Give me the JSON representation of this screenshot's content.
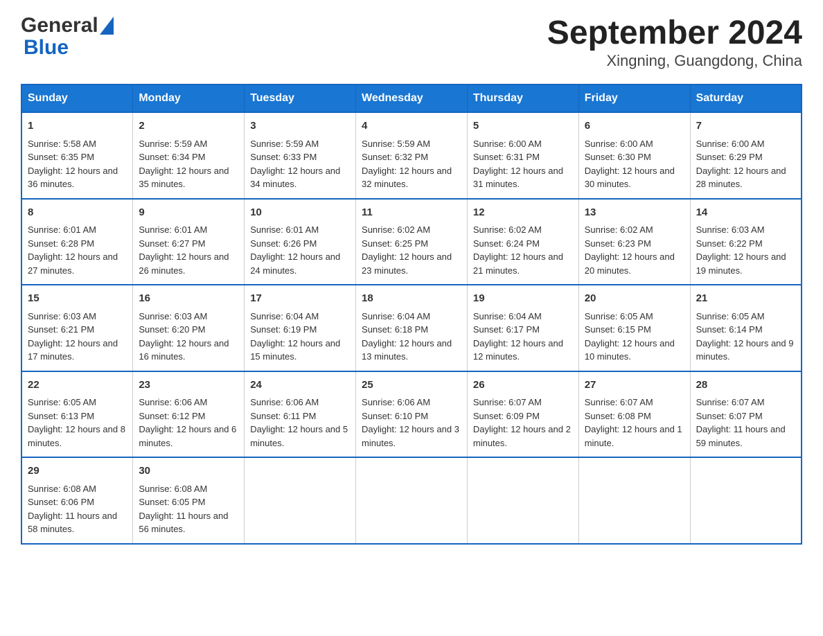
{
  "header": {
    "logo_general": "General",
    "logo_blue": "Blue",
    "month_title": "September 2024",
    "location": "Xingning, Guangdong, China"
  },
  "days_of_week": [
    "Sunday",
    "Monday",
    "Tuesday",
    "Wednesday",
    "Thursday",
    "Friday",
    "Saturday"
  ],
  "weeks": [
    [
      {
        "day": "1",
        "sunrise": "Sunrise: 5:58 AM",
        "sunset": "Sunset: 6:35 PM",
        "daylight": "Daylight: 12 hours and 36 minutes."
      },
      {
        "day": "2",
        "sunrise": "Sunrise: 5:59 AM",
        "sunset": "Sunset: 6:34 PM",
        "daylight": "Daylight: 12 hours and 35 minutes."
      },
      {
        "day": "3",
        "sunrise": "Sunrise: 5:59 AM",
        "sunset": "Sunset: 6:33 PM",
        "daylight": "Daylight: 12 hours and 34 minutes."
      },
      {
        "day": "4",
        "sunrise": "Sunrise: 5:59 AM",
        "sunset": "Sunset: 6:32 PM",
        "daylight": "Daylight: 12 hours and 32 minutes."
      },
      {
        "day": "5",
        "sunrise": "Sunrise: 6:00 AM",
        "sunset": "Sunset: 6:31 PM",
        "daylight": "Daylight: 12 hours and 31 minutes."
      },
      {
        "day": "6",
        "sunrise": "Sunrise: 6:00 AM",
        "sunset": "Sunset: 6:30 PM",
        "daylight": "Daylight: 12 hours and 30 minutes."
      },
      {
        "day": "7",
        "sunrise": "Sunrise: 6:00 AM",
        "sunset": "Sunset: 6:29 PM",
        "daylight": "Daylight: 12 hours and 28 minutes."
      }
    ],
    [
      {
        "day": "8",
        "sunrise": "Sunrise: 6:01 AM",
        "sunset": "Sunset: 6:28 PM",
        "daylight": "Daylight: 12 hours and 27 minutes."
      },
      {
        "day": "9",
        "sunrise": "Sunrise: 6:01 AM",
        "sunset": "Sunset: 6:27 PM",
        "daylight": "Daylight: 12 hours and 26 minutes."
      },
      {
        "day": "10",
        "sunrise": "Sunrise: 6:01 AM",
        "sunset": "Sunset: 6:26 PM",
        "daylight": "Daylight: 12 hours and 24 minutes."
      },
      {
        "day": "11",
        "sunrise": "Sunrise: 6:02 AM",
        "sunset": "Sunset: 6:25 PM",
        "daylight": "Daylight: 12 hours and 23 minutes."
      },
      {
        "day": "12",
        "sunrise": "Sunrise: 6:02 AM",
        "sunset": "Sunset: 6:24 PM",
        "daylight": "Daylight: 12 hours and 21 minutes."
      },
      {
        "day": "13",
        "sunrise": "Sunrise: 6:02 AM",
        "sunset": "Sunset: 6:23 PM",
        "daylight": "Daylight: 12 hours and 20 minutes."
      },
      {
        "day": "14",
        "sunrise": "Sunrise: 6:03 AM",
        "sunset": "Sunset: 6:22 PM",
        "daylight": "Daylight: 12 hours and 19 minutes."
      }
    ],
    [
      {
        "day": "15",
        "sunrise": "Sunrise: 6:03 AM",
        "sunset": "Sunset: 6:21 PM",
        "daylight": "Daylight: 12 hours and 17 minutes."
      },
      {
        "day": "16",
        "sunrise": "Sunrise: 6:03 AM",
        "sunset": "Sunset: 6:20 PM",
        "daylight": "Daylight: 12 hours and 16 minutes."
      },
      {
        "day": "17",
        "sunrise": "Sunrise: 6:04 AM",
        "sunset": "Sunset: 6:19 PM",
        "daylight": "Daylight: 12 hours and 15 minutes."
      },
      {
        "day": "18",
        "sunrise": "Sunrise: 6:04 AM",
        "sunset": "Sunset: 6:18 PM",
        "daylight": "Daylight: 12 hours and 13 minutes."
      },
      {
        "day": "19",
        "sunrise": "Sunrise: 6:04 AM",
        "sunset": "Sunset: 6:17 PM",
        "daylight": "Daylight: 12 hours and 12 minutes."
      },
      {
        "day": "20",
        "sunrise": "Sunrise: 6:05 AM",
        "sunset": "Sunset: 6:15 PM",
        "daylight": "Daylight: 12 hours and 10 minutes."
      },
      {
        "day": "21",
        "sunrise": "Sunrise: 6:05 AM",
        "sunset": "Sunset: 6:14 PM",
        "daylight": "Daylight: 12 hours and 9 minutes."
      }
    ],
    [
      {
        "day": "22",
        "sunrise": "Sunrise: 6:05 AM",
        "sunset": "Sunset: 6:13 PM",
        "daylight": "Daylight: 12 hours and 8 minutes."
      },
      {
        "day": "23",
        "sunrise": "Sunrise: 6:06 AM",
        "sunset": "Sunset: 6:12 PM",
        "daylight": "Daylight: 12 hours and 6 minutes."
      },
      {
        "day": "24",
        "sunrise": "Sunrise: 6:06 AM",
        "sunset": "Sunset: 6:11 PM",
        "daylight": "Daylight: 12 hours and 5 minutes."
      },
      {
        "day": "25",
        "sunrise": "Sunrise: 6:06 AM",
        "sunset": "Sunset: 6:10 PM",
        "daylight": "Daylight: 12 hours and 3 minutes."
      },
      {
        "day": "26",
        "sunrise": "Sunrise: 6:07 AM",
        "sunset": "Sunset: 6:09 PM",
        "daylight": "Daylight: 12 hours and 2 minutes."
      },
      {
        "day": "27",
        "sunrise": "Sunrise: 6:07 AM",
        "sunset": "Sunset: 6:08 PM",
        "daylight": "Daylight: 12 hours and 1 minute."
      },
      {
        "day": "28",
        "sunrise": "Sunrise: 6:07 AM",
        "sunset": "Sunset: 6:07 PM",
        "daylight": "Daylight: 11 hours and 59 minutes."
      }
    ],
    [
      {
        "day": "29",
        "sunrise": "Sunrise: 6:08 AM",
        "sunset": "Sunset: 6:06 PM",
        "daylight": "Daylight: 11 hours and 58 minutes."
      },
      {
        "day": "30",
        "sunrise": "Sunrise: 6:08 AM",
        "sunset": "Sunset: 6:05 PM",
        "daylight": "Daylight: 11 hours and 56 minutes."
      },
      null,
      null,
      null,
      null,
      null
    ]
  ]
}
